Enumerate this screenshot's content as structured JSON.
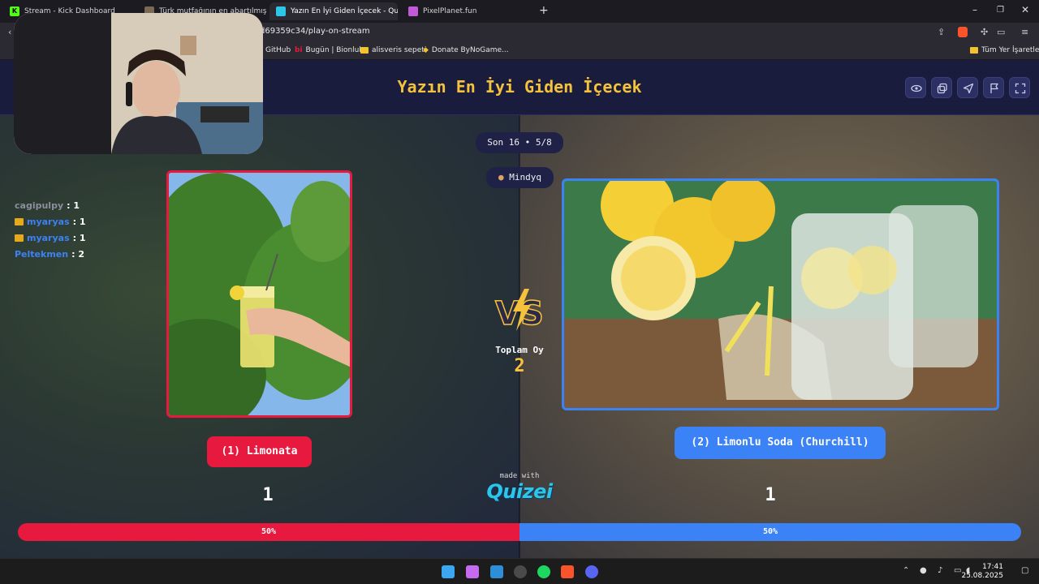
{
  "browser": {
    "tabs": [
      {
        "title": "Stream - Kick Dashboard",
        "active": false
      },
      {
        "title": "Türk mutfağının en abartılmış tadımı",
        "active": false
      },
      {
        "title": "Yazın En İyi Giden İçecek - Quizei",
        "active": true
      },
      {
        "title": "PixelPlanet.fun",
        "active": false
      }
    ],
    "new_tab": "+",
    "url": "d69359c34/play-on-stream",
    "bookmarks": [
      {
        "label": "GitHub"
      },
      {
        "label": "Bugün | Bionluk"
      },
      {
        "label": "alisveris sepeti"
      },
      {
        "label": "Donate ByNoGame..."
      },
      {
        "label": "Tüm Yer İşaretleri"
      }
    ]
  },
  "app": {
    "title": "Yazın En İyi Giden İçecek",
    "header_buttons": [
      "eye-icon",
      "copy-icon",
      "send-icon",
      "flag-icon",
      "fullscreen-icon"
    ]
  },
  "round": {
    "label": "Son 16 • 5/8",
    "player": "Mindyq"
  },
  "chat": [
    {
      "user": "cagipulpy",
      "vote": " : 1",
      "color": "#8a8f99",
      "crown": false
    },
    {
      "user": "myaryas",
      "vote": " : 1",
      "color": "#3b82f6",
      "crown": true
    },
    {
      "user": "myaryas",
      "vote": " : 1",
      "color": "#3b82f6",
      "crown": true
    },
    {
      "user": "Peltekmen",
      "vote": " : 2",
      "color": "#3b82f6",
      "crown": false
    }
  ],
  "left": {
    "name": "(1) Limonata",
    "votes": "1",
    "percent": "50%",
    "share": 0.5,
    "color": "#e8193e"
  },
  "right": {
    "name": "(2) Limonlu Soda (Churchill)",
    "votes": "1",
    "percent": "50%",
    "share": 0.5,
    "color": "#3b82f6"
  },
  "total": {
    "label": "Toplam Oy",
    "value": "2"
  },
  "branding": {
    "made_with": "made with",
    "name": "Quizei"
  },
  "taskbar": {
    "time": "17:41",
    "date": "25.08.2025"
  }
}
